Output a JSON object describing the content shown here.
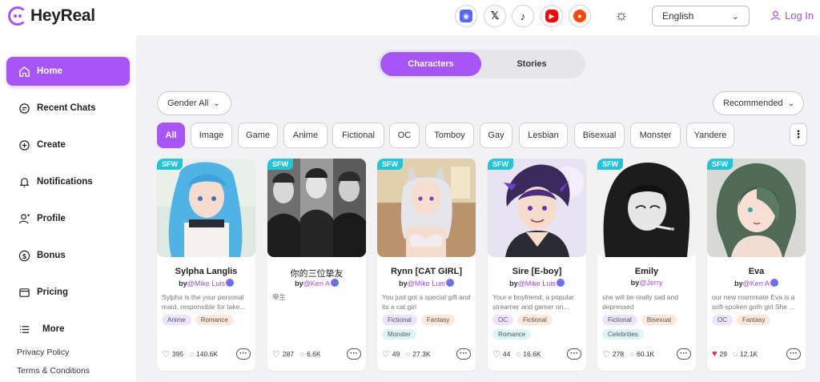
{
  "app": {
    "name": "HeyReal",
    "brand_color": "#a855f7"
  },
  "header": {
    "social": [
      {
        "name": "discord-icon",
        "color": "#5865f2"
      },
      {
        "name": "x-icon",
        "color": "#000000"
      },
      {
        "name": "tiktok-icon",
        "color": "#111111"
      },
      {
        "name": "youtube-icon",
        "color": "#ff0000"
      },
      {
        "name": "reddit-icon",
        "color": "#ff4500"
      }
    ],
    "language": "English",
    "login_label": "Log In"
  },
  "sidebar": {
    "items": [
      {
        "label": "Home",
        "icon": "home-icon"
      },
      {
        "label": "Recent Chats",
        "icon": "chat-icon"
      },
      {
        "label": "Create",
        "icon": "plus-circle-icon"
      },
      {
        "label": "Notifications",
        "icon": "bell-icon"
      },
      {
        "label": "Profile",
        "icon": "user-icon"
      },
      {
        "label": "Bonus",
        "icon": "dollar-icon"
      },
      {
        "label": "Pricing",
        "icon": "wallet-icon"
      },
      {
        "label": "More",
        "icon": "list-icon"
      }
    ],
    "footer": [
      "Privacy Policy",
      "Terms & Conditions"
    ]
  },
  "main": {
    "tabs": [
      "Characters",
      "Stories"
    ],
    "gender_filter": "Gender All",
    "sort": "Recommended",
    "categories": [
      "All",
      "Image",
      "Game",
      "Anime",
      "Fictional",
      "OC",
      "Tomboy",
      "Gay",
      "Lesbian",
      "Bisexual",
      "Monster",
      "Yandere"
    ],
    "cards": [
      {
        "badge": "SFW",
        "title": "Sylpha Langlis",
        "by": "by",
        "author": "@Mike Luis",
        "desc": "Sylpha is the your personal maid, responsible for take...",
        "tags": [
          "Anime",
          "Romance"
        ],
        "likes": "395",
        "chats": "140.6K",
        "liked": false
      },
      {
        "badge": "SFW",
        "title": "你的三位挚友",
        "by": "by",
        "author": "@Ken A",
        "desc": "學生",
        "tags": [],
        "likes": "287",
        "chats": "6.6K",
        "liked": false
      },
      {
        "badge": "SFW",
        "title": "Rynn [CAT GIRL]",
        "by": "by",
        "author": "@Mike Luis",
        "desc": "You just got a special gift and its a cat girl",
        "tags": [
          "Fictional",
          "Fantasy",
          "Monster"
        ],
        "likes": "49",
        "chats": "27.3K",
        "liked": false
      },
      {
        "badge": "SFW",
        "title": "Sire [E-boy]",
        "by": "by",
        "author": "@Mike Luis",
        "desc": "Your e boyfriend, a popular streamer and gamer on...",
        "tags": [
          "OC",
          "Fictional",
          "Romance"
        ],
        "likes": "44",
        "chats": "16.6K",
        "liked": false
      },
      {
        "badge": "SFW",
        "title": "Emily",
        "by": "by",
        "author": "@Jerry",
        "desc": "she will be really sad and depressed",
        "tags": [
          "Fictional",
          "Bisexual",
          "Celebrities"
        ],
        "likes": "278",
        "chats": "60.1K",
        "liked": false
      },
      {
        "badge": "SFW",
        "title": "Eva",
        "by": "by",
        "author": "@Ken A",
        "desc": "our new roommate Eva is a soft-spoken goth girl She ...",
        "tags": [
          "OC",
          "Fantasy"
        ],
        "likes": "29",
        "chats": "12.1K",
        "liked": true
      }
    ]
  }
}
